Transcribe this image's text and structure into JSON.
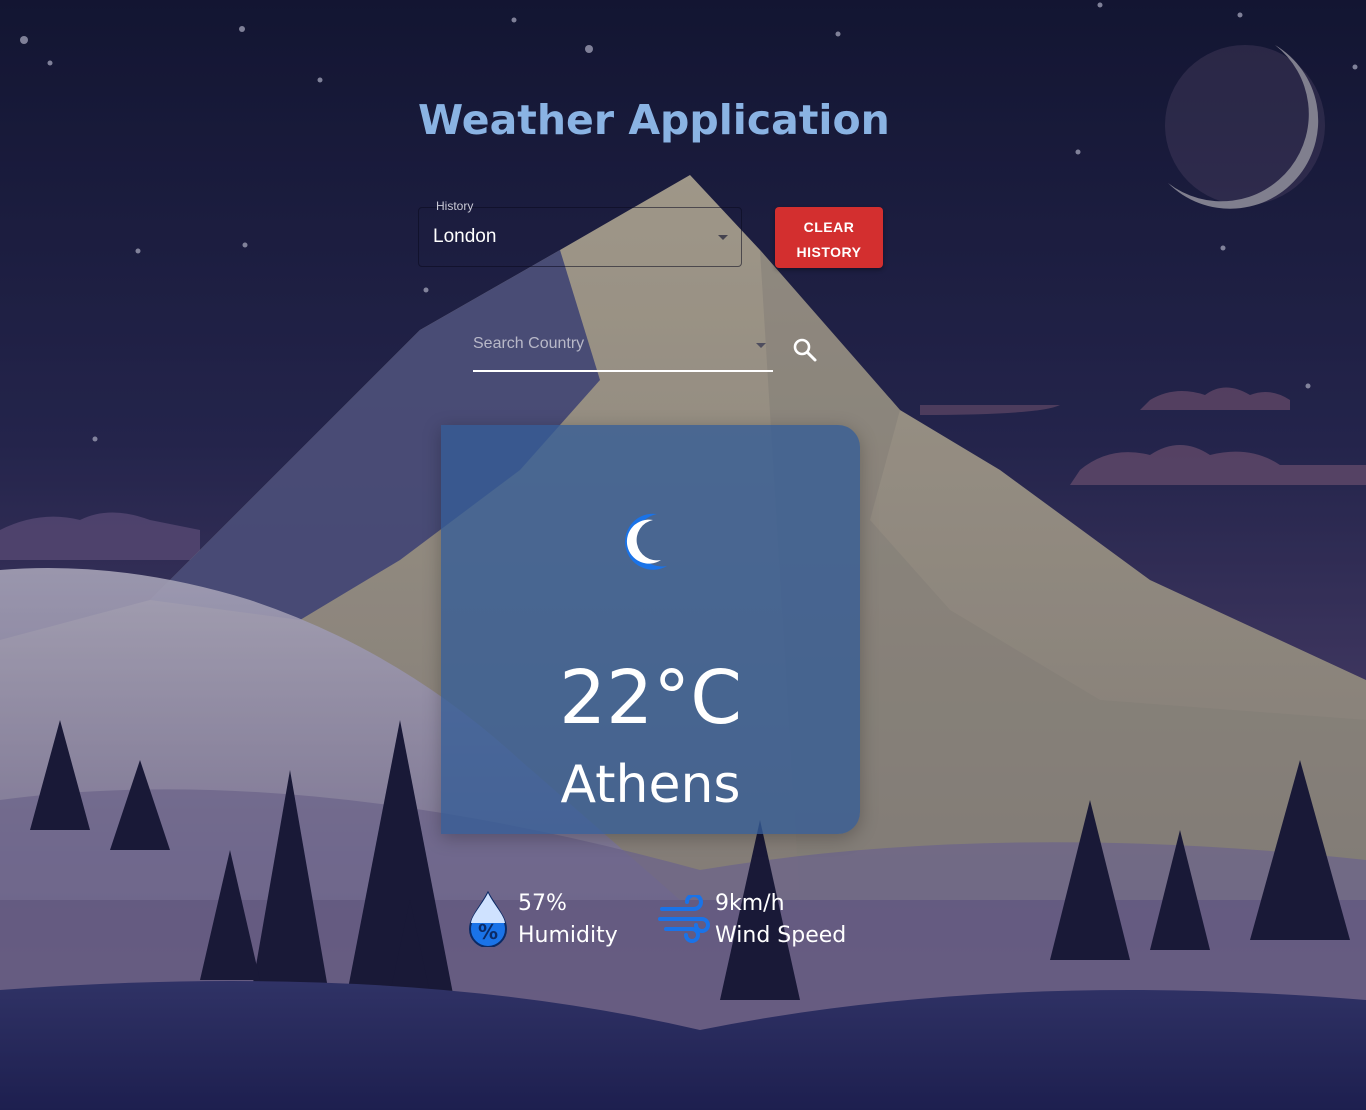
{
  "app": {
    "title": "Weather Application"
  },
  "history": {
    "label": "History",
    "selected": "London"
  },
  "clear_button": {
    "line1": "CLEAR",
    "line2": "HISTORY",
    "color": "#d32f2f"
  },
  "search": {
    "placeholder": "Search Country",
    "value": ""
  },
  "weather": {
    "icon": "crescent-moon-icon",
    "temperature": "22°C",
    "city": "Athens"
  },
  "stats": {
    "humidity": {
      "value": "57%",
      "label": "Humidity",
      "icon": "humidity-drop-icon"
    },
    "wind": {
      "value": "9km/h",
      "label": "Wind Speed",
      "icon": "wind-icon"
    }
  },
  "colors": {
    "title": "#8ab3e3",
    "card": "#345c96",
    "accent_icon": "#1a73e8"
  }
}
